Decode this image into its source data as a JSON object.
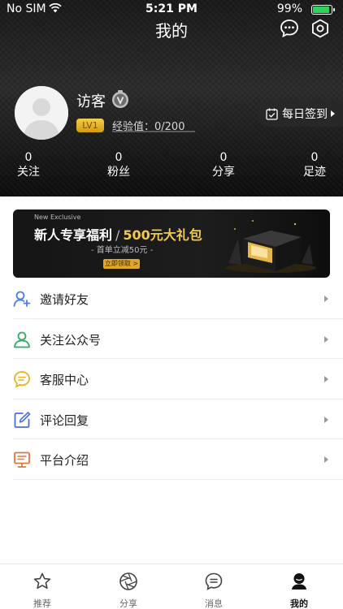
{
  "status_bar": {
    "carrier": "No SIM",
    "time": "5:21 PM",
    "battery_percent": "99%"
  },
  "nav": {
    "title": "我的"
  },
  "profile": {
    "username": "访客",
    "level": "LV1",
    "exp_text": "经验值：0/200",
    "exp_fraction": 0
  },
  "checkin": {
    "label": "每日签到"
  },
  "stats": [
    {
      "value": "0",
      "label": "关注"
    },
    {
      "value": "0",
      "label": "粉丝"
    },
    {
      "value": "0",
      "label": "分享"
    },
    {
      "value": "0",
      "label": "足迹"
    }
  ],
  "banner": {
    "tag": "New Exclusive",
    "title_left": "新人专享福利",
    "title_sep": "/",
    "title_right": "500元大礼包",
    "subtitle": "- 首单立减50元 -",
    "button": "立即领取 >"
  },
  "menu": [
    {
      "label": "邀请好友",
      "icon": "invite-friend-icon",
      "color": "#4a7ee8"
    },
    {
      "label": "关注公众号",
      "icon": "follow-account-icon",
      "color": "#2fae6a"
    },
    {
      "label": "客服中心",
      "icon": "customer-service-icon",
      "color": "#e8b21d"
    },
    {
      "label": "评论回复",
      "icon": "comment-reply-icon",
      "color": "#4a6fe8"
    },
    {
      "label": "平台介绍",
      "icon": "platform-intro-icon",
      "color": "#e0773a"
    }
  ],
  "tabs": [
    {
      "label": "推荐",
      "icon": "star-icon",
      "active": false
    },
    {
      "label": "分享",
      "icon": "aperture-icon",
      "active": false
    },
    {
      "label": "消息",
      "icon": "message-icon",
      "active": false
    },
    {
      "label": "我的",
      "icon": "profile-icon",
      "active": true
    }
  ],
  "colors": {
    "battery": "#2fd35b",
    "level_badge": "#e8b22a",
    "banner_gold": "#f3c94d"
  }
}
